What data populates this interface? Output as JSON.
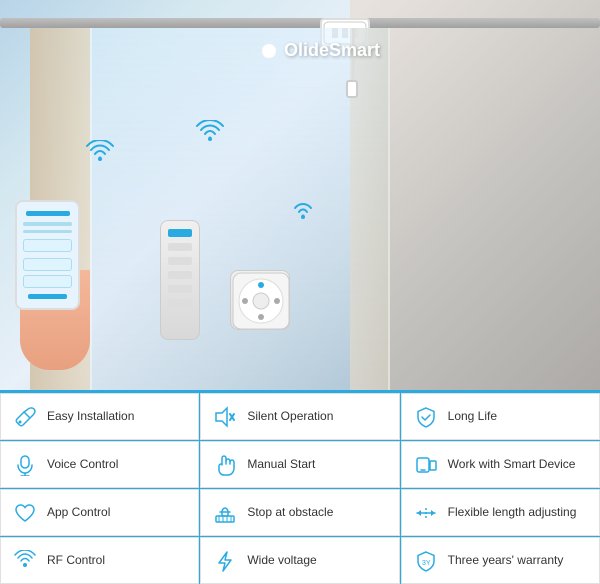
{
  "brand": "OlideSmart",
  "hero": {
    "wifi_icons": [
      "wifi",
      "wifi",
      "wifi"
    ]
  },
  "features": [
    {
      "id": "easy-installation",
      "label": "Easy Installation",
      "icon": "wrench"
    },
    {
      "id": "silent-operation",
      "label": "Silent Operation",
      "icon": "sound-off"
    },
    {
      "id": "long-life",
      "label": "Long Life",
      "icon": "shield"
    },
    {
      "id": "voice-control",
      "label": "Voice Control",
      "icon": "mic"
    },
    {
      "id": "manual-start",
      "label": "Manual Start",
      "icon": "hand"
    },
    {
      "id": "work-smart-device",
      "label": "Work with Smart Device",
      "icon": "device"
    },
    {
      "id": "app-control",
      "label": "App Control",
      "icon": "heart-app"
    },
    {
      "id": "stop-obstacle",
      "label": "Stop at obstacle",
      "icon": "obstacle"
    },
    {
      "id": "flexible-length",
      "label": "Flexible length adjusting",
      "icon": "adjust"
    },
    {
      "id": "rf-control",
      "label": "RF Control",
      "icon": "wifi-rf"
    },
    {
      "id": "wide-voltage",
      "label": "Wide voltage",
      "icon": "voltage"
    },
    {
      "id": "three-years-warranty",
      "label": "Three years' warranty",
      "icon": "warranty"
    }
  ],
  "accent_color": "#29abe2"
}
